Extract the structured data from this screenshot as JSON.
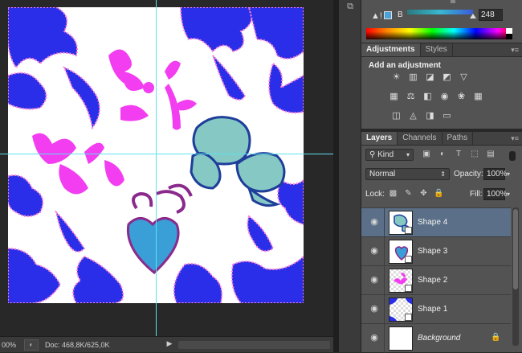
{
  "statusbar": {
    "zoom": "00%",
    "doc": "Doc: 468,8K/625,0K"
  },
  "color_panel": {
    "warning_glyph": "▲!",
    "channel_label": "B",
    "channel_value": "248",
    "swatch_color": "#4aa3d8"
  },
  "adjustments": {
    "tabs": [
      "Adjustments",
      "Styles"
    ],
    "title": "Add an adjustment",
    "icons": [
      [
        "brightness-contrast-icon",
        "levels-icon",
        "curves-icon",
        "exposure-icon",
        "gradient-icon"
      ],
      [
        "vibrance-icon",
        "balance-icon",
        "black-white-icon",
        "photo-filter-icon",
        "channel-mixer-icon",
        "color-lookup-icon"
      ],
      [
        "invert-icon",
        "posterize-icon",
        "threshold-icon",
        "selective-color-icon"
      ]
    ]
  },
  "layers": {
    "tabs": [
      "Layers",
      "Channels",
      "Paths"
    ],
    "kind_label": "Kind",
    "blend_mode": "Normal",
    "opacity_label": "Opacity:",
    "opacity_value": "100%",
    "lock_label": "Lock:",
    "fill_label": "Fill:",
    "fill_value": "100%",
    "items": [
      {
        "name": "Shape 4",
        "selected": true
      },
      {
        "name": "Shape 3",
        "selected": false
      },
      {
        "name": "Shape 2",
        "selected": false
      },
      {
        "name": "Shape 1",
        "selected": false
      },
      {
        "name": "Background",
        "selected": false,
        "italic": true,
        "locked": true
      }
    ]
  },
  "canvas": {
    "colors": {
      "blue": "#2a2ee8",
      "magenta": "#f23ef0",
      "teal": "#86c9c4",
      "navy": "#1f3e9a",
      "sky": "#3a9fd6",
      "plum": "#8a2a8c",
      "guide": "#5fe0ee"
    }
  }
}
